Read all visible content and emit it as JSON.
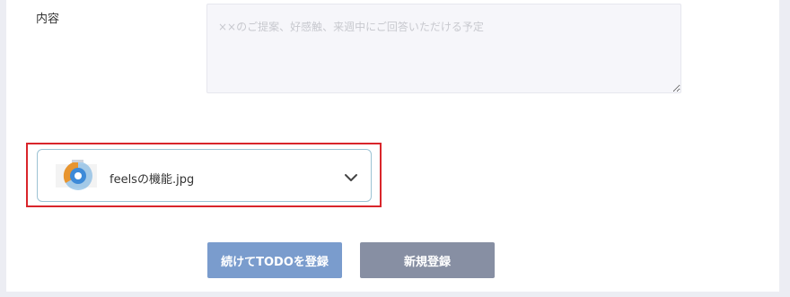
{
  "form": {
    "content_label": "内容",
    "content_placeholder": "××のご提案、好感触、来週中にご回答いただける予定",
    "content_value": ""
  },
  "attachment": {
    "file_name": "feelsの機能.jpg",
    "icon": "image-thumbnail",
    "expand_icon": "chevron-down-icon"
  },
  "buttons": {
    "continue_label": "続けてTODOを登録",
    "register_label": "新規登録"
  },
  "colors": {
    "highlight_border": "#d9252b",
    "continue_button": "#7a9ccd",
    "register_button": "#878fa3",
    "attachment_border": "#9dc3d4"
  }
}
